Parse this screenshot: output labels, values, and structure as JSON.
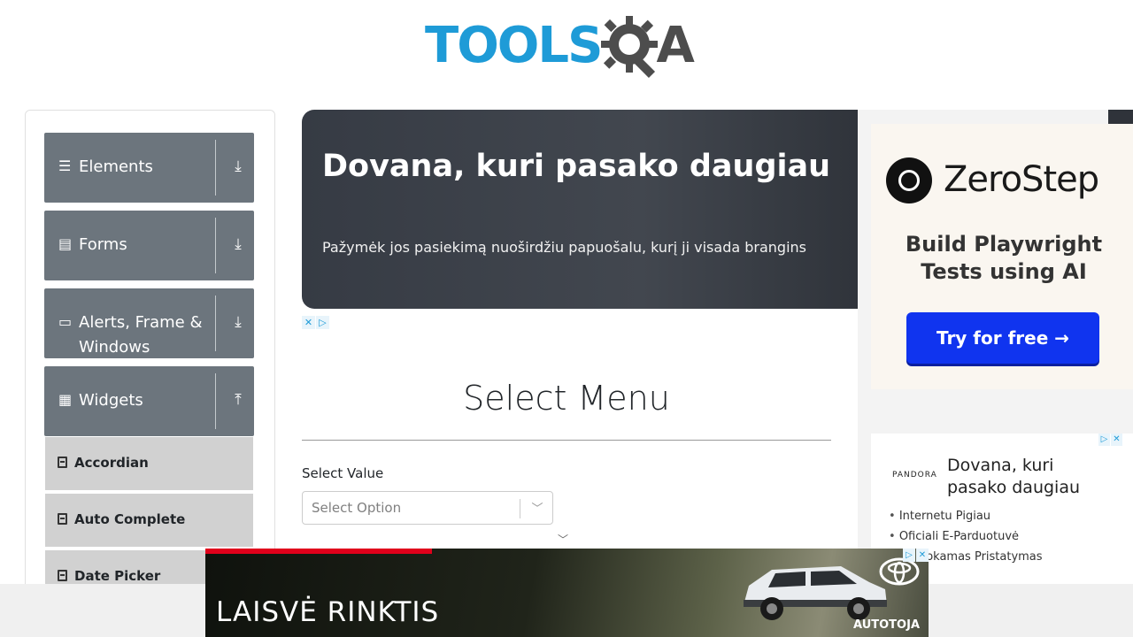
{
  "header": {
    "logo_text": "TOOLS",
    "logo_suffix": "A"
  },
  "sidebar": {
    "groups": [
      {
        "label": "Elements",
        "icon": "hamburger-icon",
        "arrow": "download-arrow-icon"
      },
      {
        "label": "Forms",
        "icon": "document-icon",
        "arrow": "download-arrow-icon"
      },
      {
        "label_line1": "Alerts, Frame &",
        "label_line2": "Windows",
        "icon": "window-icon",
        "arrow": "download-arrow-icon"
      },
      {
        "label": "Widgets",
        "icon": "grid-icon",
        "arrow": "upload-arrow-icon"
      }
    ],
    "widget_items": [
      "Accordian",
      "Auto Complete",
      "Date Picker"
    ]
  },
  "banner_ad": {
    "title": "Dovana, kuri pasako daugiau",
    "text": "Pažymėk jos pasiekimą nuoširdžiu papuošalu, kurį ji visada brangins"
  },
  "main": {
    "title": "Select Menu",
    "select_label": "Select Value",
    "select_placeholder": "Select Option"
  },
  "right_ad": {
    "brand": "ZeroStep",
    "tagline_line1": "Build Playwright",
    "tagline_line2": "Tests using AI",
    "button": "Try for free →"
  },
  "pandora_ad": {
    "logo": "PANDORA",
    "title": "Dovana, kuri pasako daugiau",
    "items": [
      "Internetu Pigiau",
      "Oficiali E-Parduotuvė",
      "Nemokamas Pristatymas"
    ]
  },
  "bottom_ad": {
    "text": "LAISVĖ RINKTIS",
    "brand": "AUTOTOJA"
  },
  "colors": {
    "logo_blue": "#1e9bd7",
    "sidebar_group": "#6c757d",
    "sidebar_item": "#d1d1d1",
    "cta_blue": "#1034ef"
  }
}
